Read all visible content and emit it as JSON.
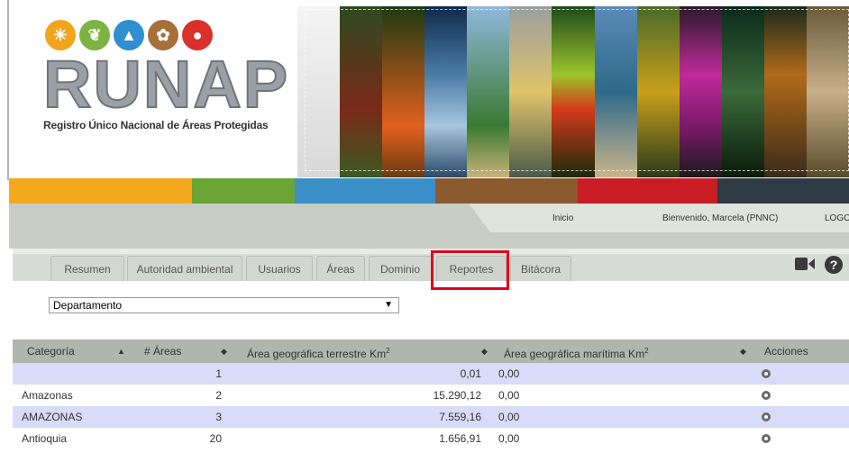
{
  "logo": {
    "word": "RUNAP",
    "subtitle": "Registro Único Nacional de Áreas Protegidas",
    "circles": [
      {
        "icon": "sun-icon",
        "color": "#f2a51c"
      },
      {
        "icon": "leaf-icon",
        "color": "#7cb342"
      },
      {
        "icon": "mountain-icon",
        "color": "#2f8fd0"
      },
      {
        "icon": "plant-icon",
        "color": "#a5703a"
      },
      {
        "icon": "bear-icon",
        "color": "#d9302c"
      }
    ]
  },
  "colorbar": [
    "#f4a81d",
    "#6aa535",
    "#3b8fc8",
    "#8a5a2e",
    "#c81d25",
    "#2e3a44"
  ],
  "topnav": {
    "inicio": "Inicio",
    "welcome": "Bienvenido, Marcela (PNNC)",
    "logout": "LOGOU"
  },
  "tabs": [
    "Resumen",
    "Autoridad ambiental",
    "Usuarios",
    "Áreas",
    "Dominio",
    "Reportes",
    "Bitácora"
  ],
  "active_tab": "Reportes",
  "select": {
    "value": "Departamento"
  },
  "table": {
    "headers": {
      "categoria": "Categoría",
      "num_areas": "# Áreas",
      "terrestre": "Área geográfica terrestre Km",
      "maritima": "Área geográfica marítima Km",
      "sup": "2",
      "acciones": "Acciones"
    },
    "rows": [
      {
        "categoria": "",
        "num": "1",
        "terrestre": "0,01",
        "maritima": "0,00"
      },
      {
        "categoria": "Amazonas",
        "num": "2",
        "terrestre": "15.290,12",
        "maritima": "0,00"
      },
      {
        "categoria": "AMAZONAS",
        "num": "3",
        "terrestre": "7.559,16",
        "maritima": "0,00"
      },
      {
        "categoria": "Antioquia",
        "num": "20",
        "terrestre": "1.656,91",
        "maritima": "0,00"
      }
    ]
  }
}
